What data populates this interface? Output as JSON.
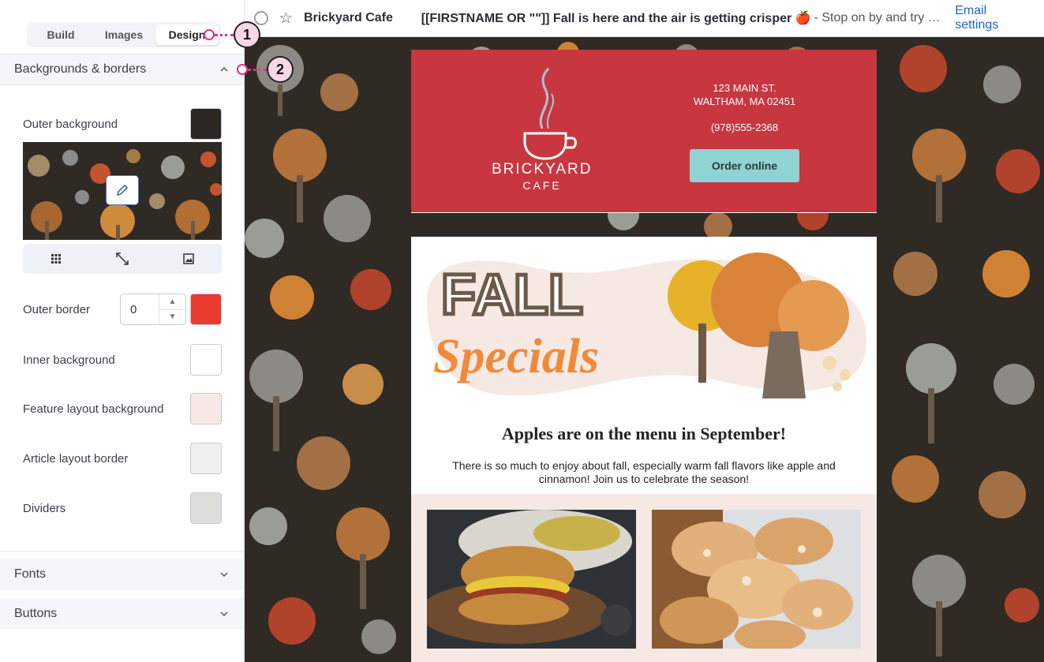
{
  "tabs": {
    "build": "Build",
    "images": "Images",
    "design": "Design"
  },
  "callouts": {
    "one": "1",
    "two": "2"
  },
  "sections": {
    "backgrounds": "Backgrounds & borders",
    "fonts": "Fonts",
    "buttons": "Buttons"
  },
  "settings": {
    "outer_background": {
      "label": "Outer background",
      "color": "#2b2722"
    },
    "outer_border": {
      "label": "Outer border",
      "value": "0",
      "color": "#ea3b2e"
    },
    "inner_background": {
      "label": "Inner background",
      "color": "#ffffff"
    },
    "feature_layout_background": {
      "label": "Feature layout background",
      "color": "#f6e9e4"
    },
    "article_layout_border": {
      "label": "Article layout border",
      "color": "#eff0f0"
    },
    "dividers": {
      "label": "Dividers",
      "color": "#dddedb"
    }
  },
  "message": {
    "sender": "Brickyard Cafe",
    "subject": "[[FIRSTNAME OR \"\"]] Fall is here and the air is getting crisper 🍎",
    "preview": "- Stop on by and try …",
    "email_settings": "Email settings"
  },
  "email": {
    "brand_name": "BRICKYARD",
    "brand_sub": "CAFE",
    "address_line1": "123 MAIN ST.",
    "address_line2": "WALTHAM, MA 02451",
    "phone": "(978)555-2368",
    "order_button": "Order online",
    "hero_word1": "FALL",
    "hero_word2": "Specials",
    "headline": "Apples are on the menu in September!",
    "paragraph": "There is so much to enjoy about fall, especially warm fall flavors like apple and cinnamon! Join us to celebrate the season!",
    "header_color": "#c8373f",
    "button_color": "#8fd3d3"
  }
}
